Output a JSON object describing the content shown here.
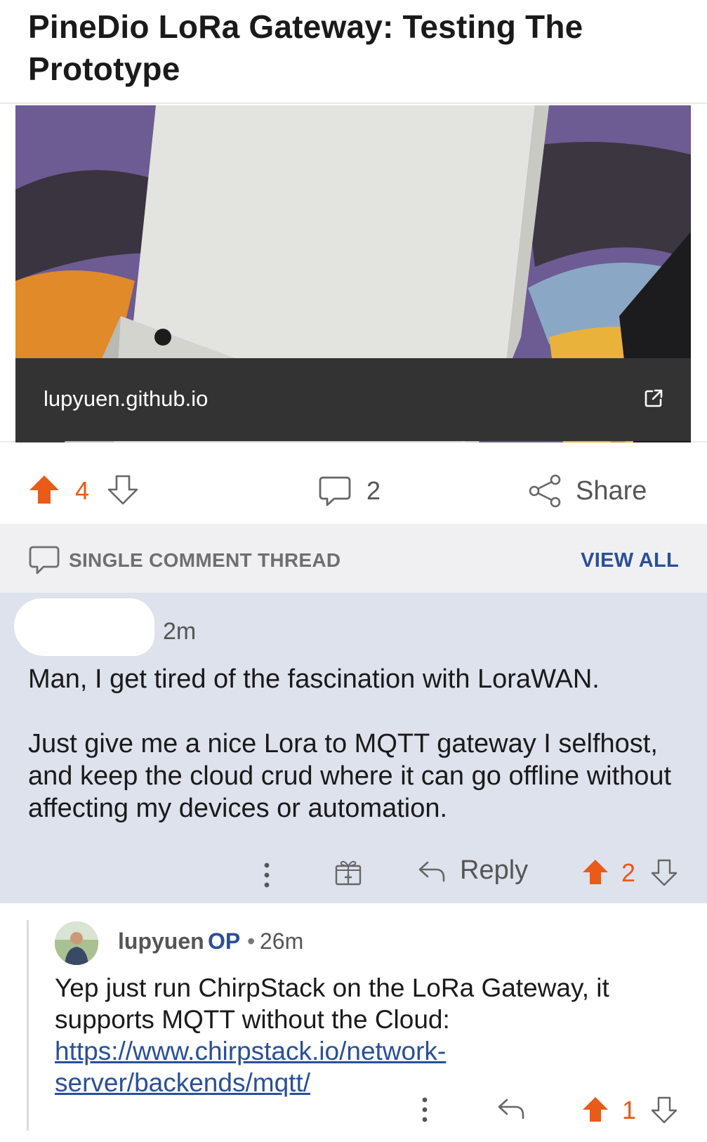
{
  "post": {
    "title": "PineDio LoRa Gateway: Testing The Prototype",
    "link_domain": "lupyuen.github.io",
    "upvotes": "4",
    "comments": "2",
    "share_label": "Share"
  },
  "thread_bar": {
    "label": "SINGLE COMMENT THREAD",
    "view_all": "VIEW ALL"
  },
  "comment1": {
    "time": "2m",
    "paragraphs": [
      "Man, I get tired of the fascination with LoraWAN.",
      "Just give me a nice Lora to MQTT gateway I selfhost, and keep the cloud crud where it can go offline without affecting my devices or automation."
    ],
    "reply_label": "Reply",
    "votes": "2"
  },
  "comment2": {
    "author": "lupyuen",
    "op_badge": "OP",
    "separator": "•",
    "time": "26m",
    "body_text": "Yep just run ChirpStack on the LoRa Gateway, it supports MQTT without the Cloud: ",
    "link_text": "https://www.chirpstack.io/network-server/backends/mqtt/",
    "votes": "1"
  },
  "colors": {
    "upvote": "#ea5a18",
    "link": "#2a4f9b",
    "comment_bg": "#dde2ed"
  }
}
